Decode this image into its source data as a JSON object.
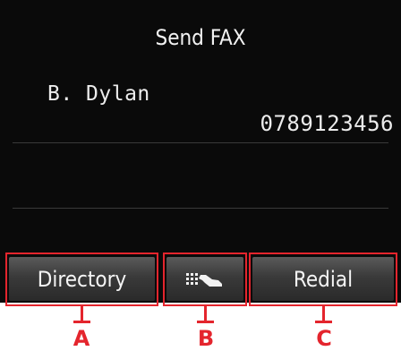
{
  "title": "Send FAX",
  "entry": {
    "name": "B. Dylan",
    "number": "0789123456"
  },
  "buttons": {
    "directory": "Directory",
    "tone_icon": "fax-tone-hand-icon",
    "redial": "Redial"
  },
  "callouts": [
    "A",
    "B",
    "C"
  ],
  "colors": {
    "screen": "#0a0a0a",
    "callout": "#e4252d"
  }
}
